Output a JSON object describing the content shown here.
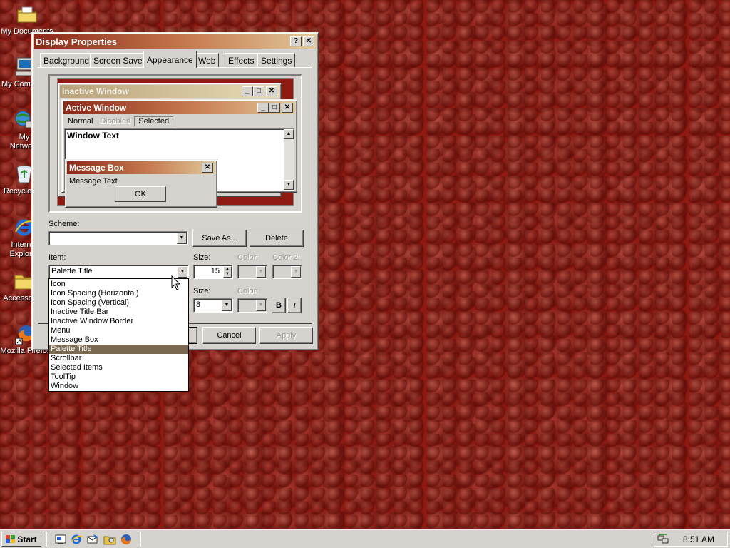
{
  "desktop": {
    "icons": [
      {
        "label": "My Documents"
      },
      {
        "label": "My Computer"
      },
      {
        "label": "My Network Places"
      },
      {
        "label": "Recycle Bin"
      },
      {
        "label": "Internet Explorer"
      },
      {
        "label": "Accessories"
      },
      {
        "label": "Mozilla Firefox"
      }
    ]
  },
  "dialog": {
    "title": "Display Properties",
    "help_btn": "?",
    "close_btn": "✕",
    "tabs": [
      {
        "label": "Background"
      },
      {
        "label": "Screen Saver"
      },
      {
        "label": "Appearance",
        "active": true
      },
      {
        "label": "Web"
      },
      {
        "label": "Effects"
      },
      {
        "label": "Settings"
      }
    ],
    "preview": {
      "inactive_title": "Inactive Window",
      "active_title": "Active Window",
      "menu_normal": "Normal",
      "menu_disabled": "Disabled",
      "menu_selected": "Selected",
      "window_text": "Window Text",
      "message_title": "Message Box",
      "message_text": "Message Text",
      "ok_label": "OK"
    },
    "scheme": {
      "label": "Scheme:",
      "value": "",
      "save_as": "Save As...",
      "delete": "Delete"
    },
    "item": {
      "label": "Item:",
      "value": "Palette Title",
      "size_label": "Size:",
      "size_value": "15",
      "color_label": "Color:",
      "color2_label": "Color 2:",
      "options": [
        "Icon",
        "Icon Spacing (Horizontal)",
        "Icon Spacing (Vertical)",
        "Inactive Title Bar",
        "Inactive Window Border",
        "Menu",
        "Message Box",
        "Palette Title",
        "Scrollbar",
        "Selected Items",
        "ToolTip",
        "Window"
      ],
      "selected_option": "Palette Title"
    },
    "font": {
      "size_label": "Size:",
      "size_value": "8",
      "color_label": "Color:",
      "bold_label": "B",
      "italic_label": "I"
    },
    "buttons": {
      "cancel": "Cancel",
      "apply": "Apply"
    }
  },
  "taskbar": {
    "start_label": "Start",
    "clock": "8:51 AM"
  },
  "colors": {
    "desktop": "#8e1a12",
    "title_gradient_start": "#8b2818",
    "title_gradient_end": "#e0c99c",
    "selection": "#7a6a52",
    "face": "#d6d3ce"
  }
}
